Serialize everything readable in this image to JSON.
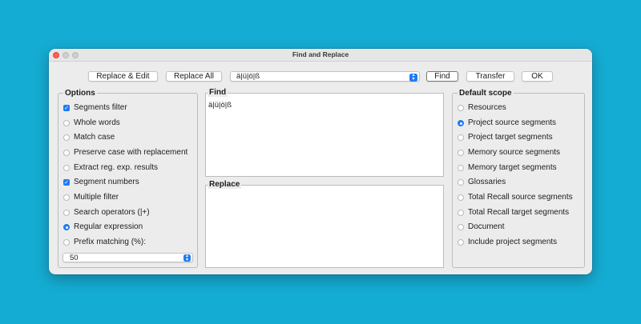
{
  "window": {
    "title": "Find and Replace"
  },
  "toolbar": {
    "replace_edit_label": "Replace & Edit",
    "replace_all_label": "Replace All",
    "search_value": "ä|ü|ö|ß",
    "find_label": "Find",
    "transfer_label": "Transfer",
    "ok_label": "OK"
  },
  "options": {
    "title": "Options",
    "items": [
      {
        "label": "Segments filter",
        "kind": "checkbox",
        "checked": true
      },
      {
        "label": "Whole words",
        "kind": "radio",
        "checked": false
      },
      {
        "label": "Match case",
        "kind": "radio",
        "checked": false
      },
      {
        "label": "Preserve case with replacement",
        "kind": "radio",
        "checked": false
      },
      {
        "label": "Extract reg. exp. results",
        "kind": "radio",
        "checked": false
      },
      {
        "label": "Segment numbers",
        "kind": "checkbox",
        "checked": true
      },
      {
        "label": "Multiple filter",
        "kind": "radio",
        "checked": false
      },
      {
        "label": "Search operators (|+)",
        "kind": "radio",
        "checked": false
      },
      {
        "label": "Regular expression",
        "kind": "radio",
        "checked": true
      },
      {
        "label": "Prefix matching (%):",
        "kind": "radio",
        "checked": false
      }
    ],
    "prefix_value": "50"
  },
  "find": {
    "title": "Find",
    "text": "ä|ü|ö|ß"
  },
  "replace": {
    "title": "Replace",
    "text": ""
  },
  "scope": {
    "title": "Default scope",
    "items": [
      {
        "label": "Resources",
        "checked": false
      },
      {
        "label": "Project source segments",
        "checked": true
      },
      {
        "label": "Project target segments",
        "checked": false
      },
      {
        "label": "Memory source segments",
        "checked": false
      },
      {
        "label": "Memory target segments",
        "checked": false
      },
      {
        "label": "Glossaries",
        "checked": false
      },
      {
        "label": "Total Recall source segments",
        "checked": false
      },
      {
        "label": "Total Recall target segments",
        "checked": false
      },
      {
        "label": "Document",
        "checked": false
      },
      {
        "label": "Include project segments",
        "checked": false
      }
    ]
  },
  "colors": {
    "accent": "#1f7bf3",
    "background": "#15acd3",
    "window": "#ececec"
  }
}
